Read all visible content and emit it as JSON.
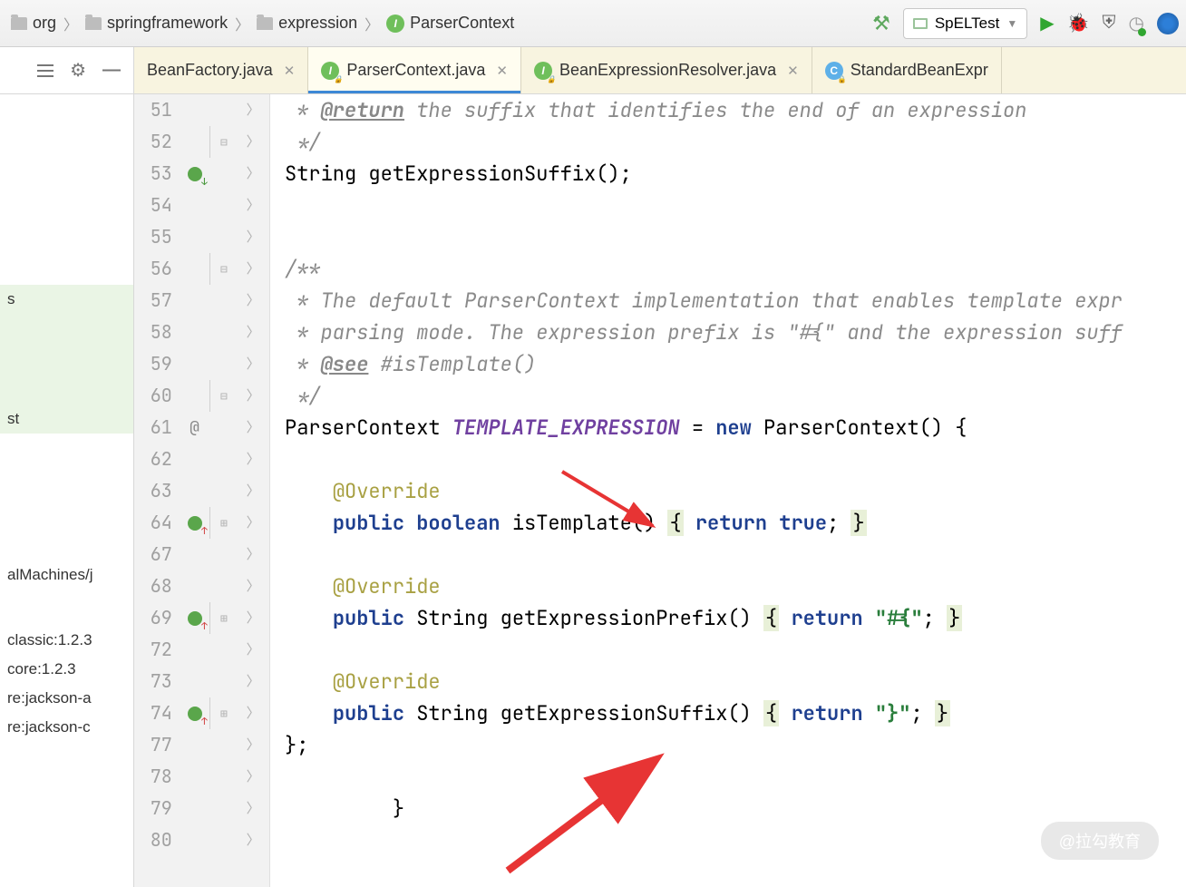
{
  "breadcrumbs": {
    "p1": "org",
    "p2": "springframework",
    "p3": "expression",
    "p4": "ParserContext"
  },
  "runConfig": "SpELTest",
  "tabs": {
    "t1": "BeanFactory.java",
    "t2": "ParserContext.java",
    "t3": "BeanExpressionResolver.java",
    "t4": "StandardBeanExpr"
  },
  "leftPanel": {
    "i1": "s",
    "i2": "st",
    "i3": "alMachines/j",
    "i4": "classic:1.2.3",
    "i5": "core:1.2.3",
    "i6": "re:jackson-a",
    "i7": "re:jackson-c"
  },
  "lines": [
    "51",
    "52",
    "53",
    "54",
    "55",
    "56",
    "57",
    "58",
    "59",
    "60",
    "61",
    "62",
    "63",
    "64",
    "67",
    "68",
    "69",
    "72",
    "73",
    "74",
    "77",
    "78",
    "79",
    "80"
  ],
  "code": {
    "l51a": " * ",
    "l51b": "@return",
    "l51c": " the suffix that identifies the end of an expression",
    "l52": " */",
    "l53": "String getExpressionSuffix();",
    "l56": "/**",
    "l57": " * The default ParserContext implementation that enables template expr",
    "l58": " * parsing mode. The expression prefix is \"#{\" and the expression suff",
    "l59a": " * ",
    "l59b": "@see",
    "l59c": " #isTemplate()",
    "l60": " */",
    "l61a": "ParserContext ",
    "l61b": "TEMPLATE_EXPRESSION",
    "l61c": " = ",
    "l61d": "new",
    "l61e": " ParserContext() {",
    "l63": "@Override",
    "l64a": "public",
    "l64b": "boolean",
    "l64c": " isTemplate() ",
    "l64d": "{",
    "l64e": "return",
    "l64f": "true",
    "l64g": "; ",
    "l64h": "}",
    "l68": "@Override",
    "l69a": "public",
    "l69b": " String getExpressionPrefix() ",
    "l69c": "{",
    "l69d": "return",
    "l69e": "\"#{\"",
    "l69f": "; ",
    "l69g": "}",
    "l73": "@Override",
    "l74a": "public",
    "l74b": " String getExpressionSuffix() ",
    "l74c": "{",
    "l74d": "return",
    "l74e": "\"}\"",
    "l74f": "; ",
    "l74g": "}",
    "l77": "};",
    "l79": "}"
  },
  "watermark": "@拉勾教育"
}
